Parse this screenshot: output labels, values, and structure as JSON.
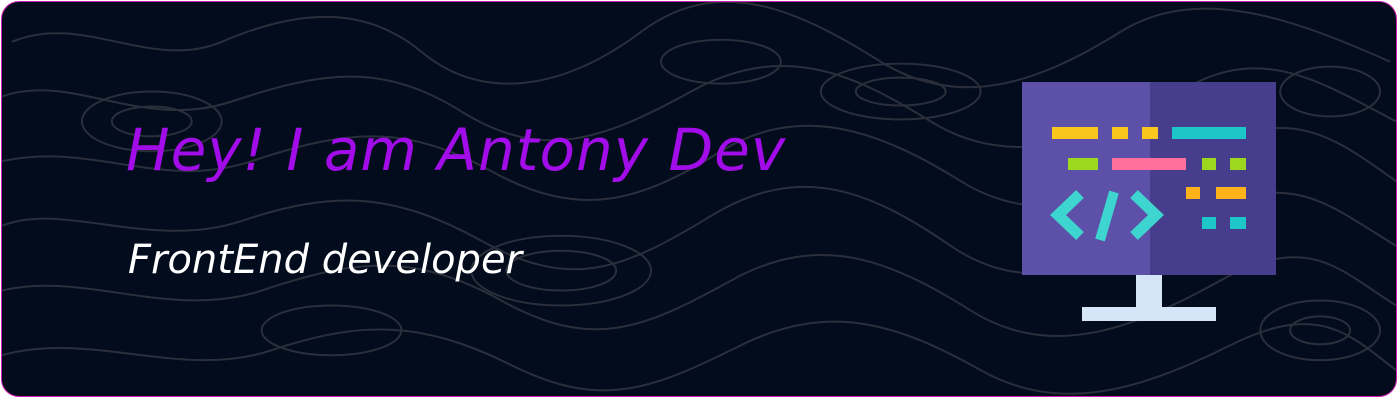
{
  "banner": {
    "title": "Hey! I am Antony Dev",
    "subtitle": "FrontEnd developer"
  },
  "icons": {
    "illustration": "code-monitor-icon",
    "background": "topographic-lines"
  },
  "colors": {
    "background": "#020c1d",
    "border": "#d21fb0",
    "title": "#a20ce8",
    "subtitle": "#ffffff",
    "topo_lines": "#2a2f3b",
    "screen_left": "#5d50a8",
    "screen_right": "#463e8c",
    "stand": "#d6e6f8",
    "yellow": "#f9c61d",
    "cyan": "#1cc6c9",
    "lime": "#9dd81f",
    "pink": "#ff6f9c",
    "orange": "#ffb21a"
  }
}
